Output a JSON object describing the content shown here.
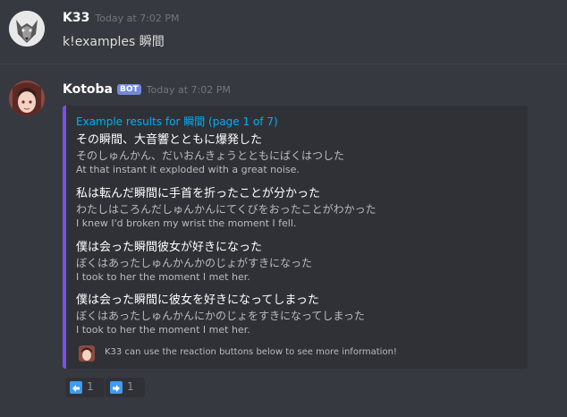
{
  "messages": [
    {
      "username": "K33",
      "timestamp": "Today at 7:02 PM",
      "content": "k!examples 瞬間",
      "avatar_icon": "wolf-avatar"
    },
    {
      "username": "Kotoba",
      "badge": "BOT",
      "timestamp": "Today at 7:02 PM",
      "avatar_icon": "anime-girl-avatar",
      "embed": {
        "accent_color": "#7851e6",
        "title": "Example results for 瞬間 (page 1 of 7)",
        "examples": [
          {
            "japanese": "その瞬間、大音響とともに爆発した",
            "reading": "そのしゅんかん、だいおんきょうとともにばくはつした",
            "english": "At that instant it exploded with a great noise."
          },
          {
            "japanese": "私は転んだ瞬間に手首を折ったことが分かった",
            "reading": "わたしはころんだしゅんかんにてくびをおったことがわかった",
            "english": "I knew I'd broken my wrist the moment I fell."
          },
          {
            "japanese": "僕は会った瞬間彼女が好きになった",
            "reading": "ぼくはあったしゅんかんかのじょがすきになった",
            "english": "I took to her the moment I met her."
          },
          {
            "japanese": "僕は会った瞬間に彼女を好きになってしまった",
            "reading": "ぼくはあったしゅんかんにかのじょをすきになってしまった",
            "english": "I took to her the moment I met her."
          }
        ],
        "footer_text": "K33 can use the reaction buttons below to see more information!"
      },
      "reactions": [
        {
          "icon": "arrow-left-icon",
          "count": "1"
        },
        {
          "icon": "arrow-right-icon",
          "count": "1"
        }
      ]
    }
  ]
}
